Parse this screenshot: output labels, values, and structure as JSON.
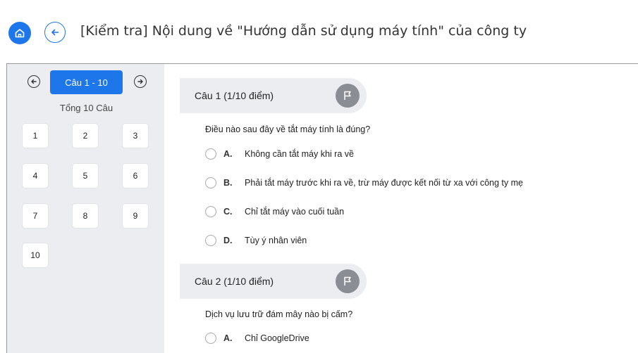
{
  "header": {
    "title": "[Kiểm tra] Nội dung về \"Hướng dẫn sử dụng máy tính\" của công ty",
    "home_icon": "home-icon",
    "back_icon": "arrow-left-icon"
  },
  "sidebar": {
    "range_label": "Câu 1 - 10",
    "total_label": "Tổng 10 Câu",
    "prev_icon": "circle-arrow-left-icon",
    "next_icon": "circle-arrow-right-icon",
    "questions": [
      "1",
      "2",
      "3",
      "4",
      "5",
      "6",
      "7",
      "8",
      "9",
      "10"
    ]
  },
  "questions": [
    {
      "header": "Câu 1 (1/10 điểm)",
      "text": "Điều nào sau đây về tắt máy tính là đúng?",
      "options": [
        {
          "letter": "A.",
          "text": "Không cần tắt máy khi ra về"
        },
        {
          "letter": "B.",
          "text": "Phải tắt máy trước khi ra về, trừ máy được kết nối từ xa với công ty mẹ"
        },
        {
          "letter": "C.",
          "text": "Chỉ tắt máy vào cuối tuần"
        },
        {
          "letter": "D.",
          "text": "Tùy ý nhân viên"
        }
      ]
    },
    {
      "header": "Câu 2 (1/10 điểm)",
      "text": "Dịch vụ lưu trữ đám mây nào bị cấm?",
      "options": [
        {
          "letter": "A.",
          "text": "Chỉ GoogleDrive"
        }
      ]
    }
  ],
  "colors": {
    "accent": "#1e77ea",
    "sidebar_bg": "#ebedf0",
    "flag_bg": "#8a8d93"
  }
}
